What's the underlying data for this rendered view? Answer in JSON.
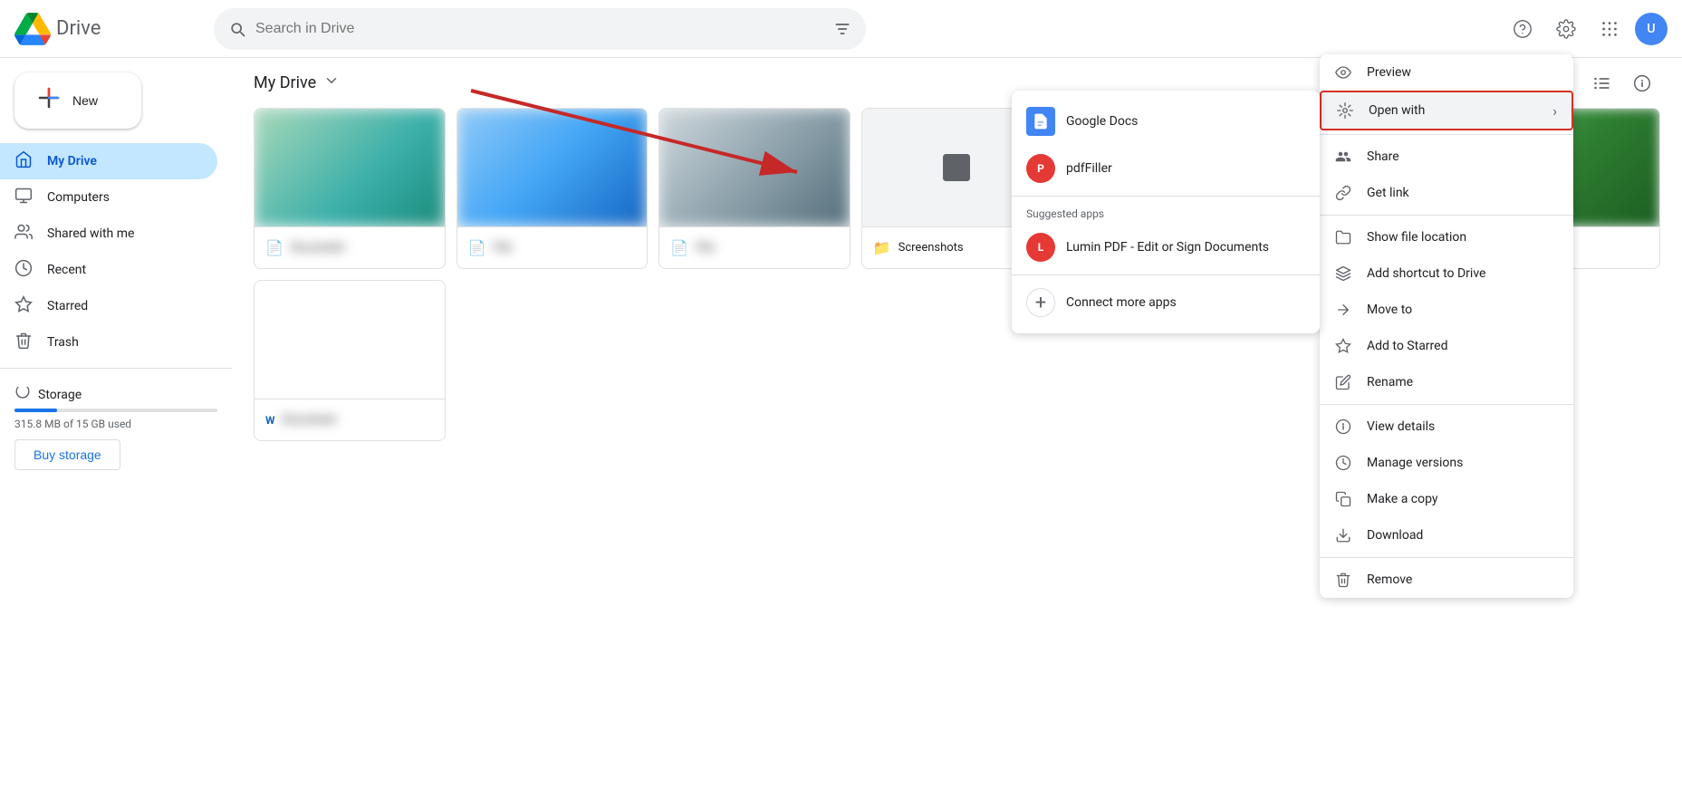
{
  "app": {
    "title": "Drive",
    "logo_alt": "Google Drive"
  },
  "topbar": {
    "search_placeholder": "Search in Drive",
    "help_label": "Help",
    "settings_label": "Settings",
    "apps_label": "Google apps"
  },
  "sidebar": {
    "new_button": "New",
    "items": [
      {
        "id": "my-drive",
        "label": "My Drive",
        "icon": "💾",
        "active": true
      },
      {
        "id": "computers",
        "label": "Computers",
        "icon": "🖥",
        "active": false
      },
      {
        "id": "shared-with-me",
        "label": "Shared with me",
        "icon": "👤",
        "active": false
      },
      {
        "id": "recent",
        "label": "Recent",
        "icon": "🕐",
        "active": false
      },
      {
        "id": "starred",
        "label": "Starred",
        "icon": "☆",
        "active": false
      },
      {
        "id": "trash",
        "label": "Trash",
        "icon": "🗑",
        "active": false
      }
    ],
    "storage": {
      "label": "Storage",
      "used": "315.8 MB of 15 GB used",
      "buy_label": "Buy storage"
    }
  },
  "main": {
    "drive_title": "My Drive",
    "folders": [
      {
        "name": "Screenshots",
        "icon": "📁"
      }
    ]
  },
  "context_menu": {
    "items": [
      {
        "id": "preview",
        "label": "Preview",
        "icon": "👁"
      },
      {
        "id": "open-with",
        "label": "Open with",
        "icon": "⊕",
        "has_arrow": true,
        "highlighted": true
      },
      {
        "id": "share",
        "label": "Share",
        "icon": "👥"
      },
      {
        "id": "get-link",
        "label": "Get link",
        "icon": "🔗"
      },
      {
        "id": "show-file-location",
        "label": "Show file location",
        "icon": "📂"
      },
      {
        "id": "add-shortcut",
        "label": "Add shortcut to Drive",
        "icon": "⌂"
      },
      {
        "id": "move-to",
        "label": "Move to",
        "icon": "📤"
      },
      {
        "id": "add-to-starred",
        "label": "Add to Starred",
        "icon": "☆"
      },
      {
        "id": "rename",
        "label": "Rename",
        "icon": "✏"
      },
      {
        "id": "view-details",
        "label": "View details",
        "icon": "ℹ"
      },
      {
        "id": "manage-versions",
        "label": "Manage versions",
        "icon": "🕐"
      },
      {
        "id": "make-copy",
        "label": "Make a copy",
        "icon": "📋"
      },
      {
        "id": "download",
        "label": "Download",
        "icon": "⬇"
      },
      {
        "id": "remove",
        "label": "Remove",
        "icon": "🗑"
      }
    ]
  },
  "open_with_submenu": {
    "primary_apps": [
      {
        "id": "google-docs",
        "label": "Google Docs",
        "icon": "docs"
      },
      {
        "id": "pdf-filler",
        "label": "pdfFiller",
        "icon": "pdf"
      }
    ],
    "suggested_label": "Suggested apps",
    "suggested_apps": [
      {
        "id": "lumin-pdf",
        "label": "Lumin PDF - Edit or Sign Documents",
        "icon": "lumin"
      }
    ],
    "connect_label": "Connect more apps"
  }
}
